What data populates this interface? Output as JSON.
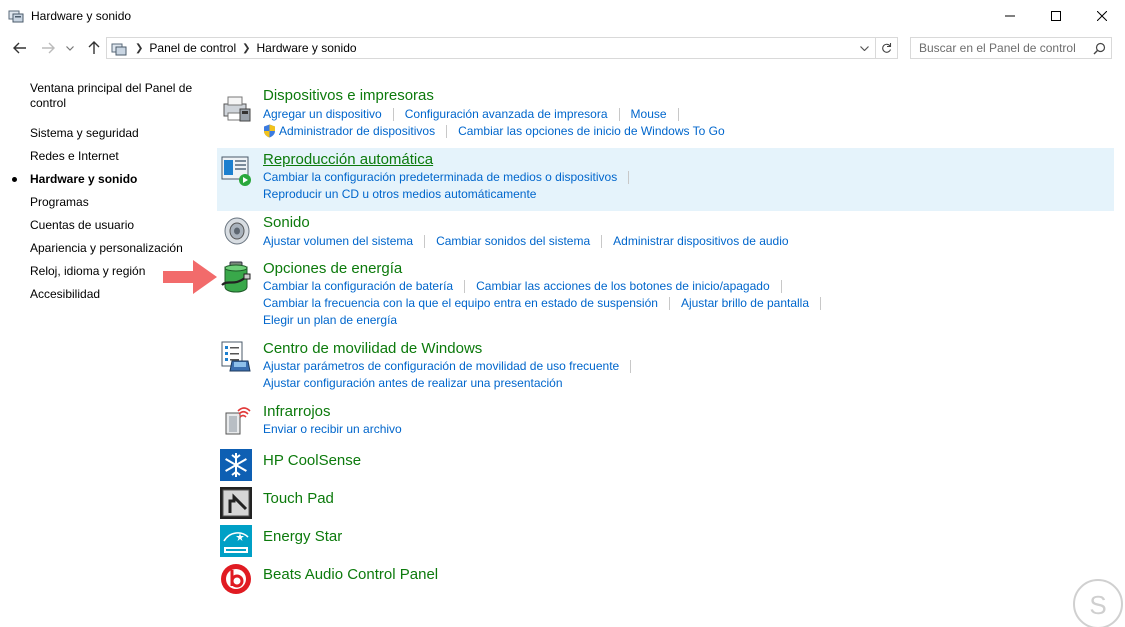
{
  "window": {
    "title": "Hardware y sonido",
    "icon": "control-panel-icon"
  },
  "address": {
    "breadcrumbs": [
      "Panel de control",
      "Hardware y sonido"
    ],
    "search_placeholder": "Buscar en el Panel de control"
  },
  "sidebar": {
    "items": [
      {
        "label": "Ventana principal del Panel de control",
        "active": false
      },
      {
        "label": "Sistema y seguridad",
        "active": false
      },
      {
        "label": "Redes e Internet",
        "active": false
      },
      {
        "label": "Hardware y sonido",
        "active": true
      },
      {
        "label": "Programas",
        "active": false
      },
      {
        "label": "Cuentas de usuario",
        "active": false
      },
      {
        "label": "Apariencia y personalización",
        "active": false
      },
      {
        "label": "Reloj, idioma y región",
        "active": false
      },
      {
        "label": "Accesibilidad",
        "active": false
      }
    ]
  },
  "sections": {
    "devices": {
      "title": "Dispositivos e impresoras",
      "links": [
        "Agregar un dispositivo",
        "Configuración avanzada de impresora",
        "Mouse",
        "Administrador de dispositivos",
        "Cambiar las opciones de inicio de Windows To Go"
      ]
    },
    "autoplay": {
      "title": "Reproducción automática",
      "links": [
        "Cambiar la configuración predeterminada de medios o dispositivos",
        "Reproducir un CD u otros medios automáticamente"
      ]
    },
    "sound": {
      "title": "Sonido",
      "links": [
        "Ajustar volumen del sistema",
        "Cambiar sonidos del sistema",
        "Administrar dispositivos de audio"
      ]
    },
    "power": {
      "title": "Opciones de energía",
      "links": [
        "Cambiar la configuración de batería",
        "Cambiar las acciones de los botones de inicio/apagado",
        "Cambiar la frecuencia con la que el equipo entra en estado de suspensión",
        "Ajustar brillo de pantalla",
        "Elegir un plan de energía"
      ]
    },
    "mobility": {
      "title": "Centro de movilidad de Windows",
      "links": [
        "Ajustar parámetros de configuración de movilidad de uso frecuente",
        "Ajustar configuración antes de realizar una presentación"
      ]
    },
    "infrared": {
      "title": "Infrarrojos",
      "links": [
        "Enviar o recibir un archivo"
      ]
    },
    "coolsense": {
      "title": "HP CoolSense"
    },
    "touchpad": {
      "title": "Touch Pad"
    },
    "energystar": {
      "title": "Energy Star"
    },
    "beats": {
      "title": "Beats Audio Control Panel"
    }
  },
  "colors": {
    "section_title": "#0c7a0c",
    "link": "#0066cc",
    "highlight": "#e5f3fb",
    "arrow": "#f26b6b"
  }
}
